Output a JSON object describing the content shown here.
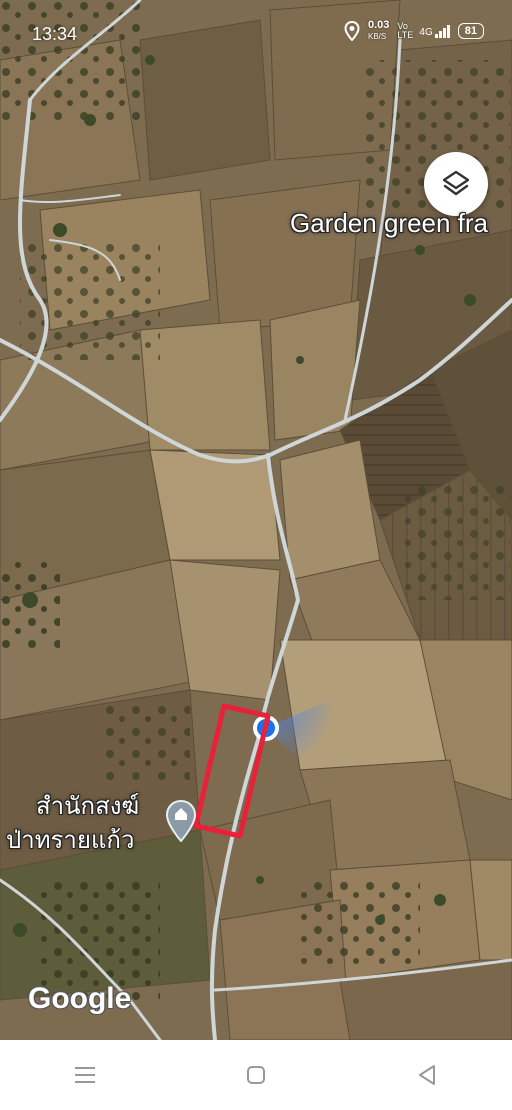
{
  "status_bar": {
    "time": "13:34",
    "net_speed_value": "0.03",
    "net_speed_unit": "KB/S",
    "volte": "Vo LTE",
    "network": "4G",
    "battery": "81"
  },
  "map": {
    "type": "satellite",
    "colors": {
      "field_base": "#7a6a4f",
      "road": "#cfd6d8",
      "boundary": "#e8203a",
      "blue_dot": "#1a73e8"
    },
    "labels": {
      "top_right_place": "Garden green fra",
      "temple_line1": "สำนักสงฆ์",
      "temple_line2": "ป่าทรายแก้ว"
    },
    "icons": {
      "layers": "layers-icon",
      "temple": "temple-pin-icon",
      "location": "my-location-dot"
    },
    "attribution": "Google"
  },
  "nav_bar": {
    "buttons": [
      "menu-button",
      "home-button",
      "back-button"
    ]
  }
}
